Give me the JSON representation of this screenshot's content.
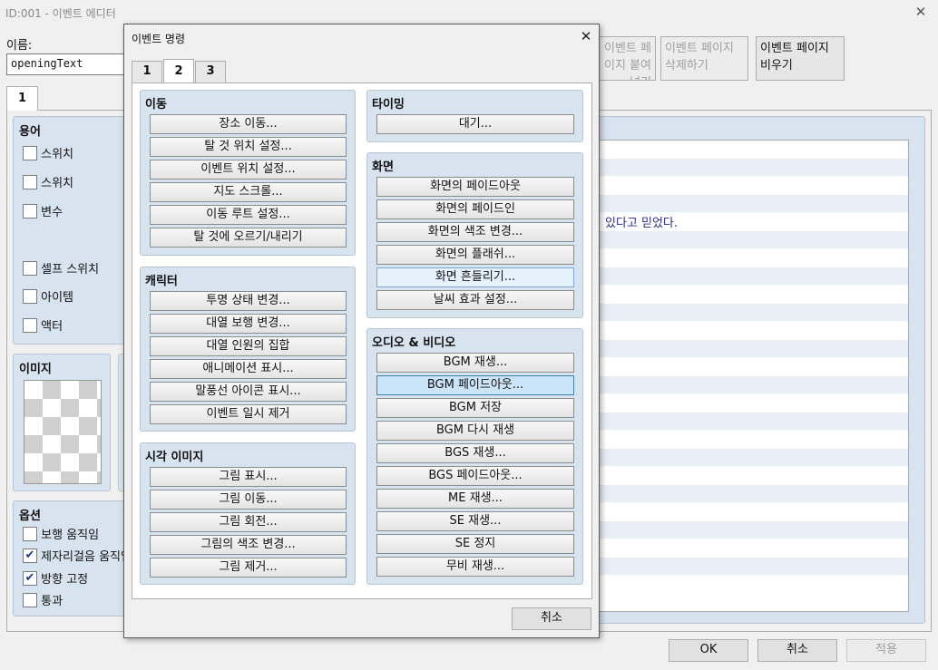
{
  "window": {
    "title": "ID:001 - 이벤트 에디터"
  },
  "name_field": {
    "label": "이름:",
    "value": "openingText"
  },
  "event_page_tabs": [
    "1"
  ],
  "page_buttons": [
    {
      "label": "이벤트 페이지 붙여넣기",
      "disabled": true
    },
    {
      "label": "이벤트 페이지 삭제하기",
      "disabled": true
    },
    {
      "label": "이벤트 페이지 비우기",
      "disabled": false
    }
  ],
  "conditions": {
    "title": "용어",
    "items": [
      "스위치",
      "스위치",
      "변수",
      "셀프 스위치",
      "아이템",
      "액터"
    ]
  },
  "image_group": {
    "title": "이미지"
  },
  "options": {
    "title": "옵션",
    "items": [
      {
        "label": "보행 움직임",
        "checked": false
      },
      {
        "label": "제자리걸음 움직임",
        "checked": true
      },
      {
        "label": "방향 고정",
        "checked": true
      },
      {
        "label": "통과",
        "checked": false
      }
    ]
  },
  "contents_visible_text": "있다고 믿었다.",
  "footer": {
    "ok": "OK",
    "cancel": "취소",
    "apply": "적용"
  },
  "dialog": {
    "title": "이벤트 명령",
    "tabs": [
      "1",
      "2",
      "3"
    ],
    "active_tab": "2",
    "groups": {
      "movement": {
        "title": "이동",
        "buttons": [
          "장소 이동...",
          "탈 것 위치 설정...",
          "이벤트 위치 설정...",
          "지도 스크롤...",
          "이동 루트 설정...",
          "탈 것에 오르기/내리기"
        ]
      },
      "character": {
        "title": "캐릭터",
        "buttons": [
          "투명 상태 변경...",
          "대열 보행 변경...",
          "대열 인원의 집합",
          "애니메이션 표시...",
          "말풍선 아이콘 표시...",
          "이벤트 일시 제거"
        ]
      },
      "picture": {
        "title": "시각 이미지",
        "buttons": [
          "그림 표시...",
          "그림 이동...",
          "그림 회전...",
          "그림의 색조 변경...",
          "그림 제거..."
        ]
      },
      "timing": {
        "title": "타이밍",
        "buttons": [
          "대기..."
        ]
      },
      "screen": {
        "title": "화면",
        "buttons": [
          "화면의 페이드아웃",
          "화면의 페이드인",
          "화면의 색조 변경...",
          "화면의 플래쉬...",
          "화면 흔들리기...",
          "날씨 효과 설정..."
        ]
      },
      "audio": {
        "title": "오디오 & 비디오",
        "buttons": [
          "BGM 재생...",
          "BGM 페이드아웃...",
          "BGM 저장",
          "BGM 다시 재생",
          "BGS 재생...",
          "BGS 페이드아웃...",
          "ME 재생...",
          "SE 재생...",
          "SE 정지",
          "무비 재생..."
        ]
      }
    },
    "cancel": "취소"
  }
}
